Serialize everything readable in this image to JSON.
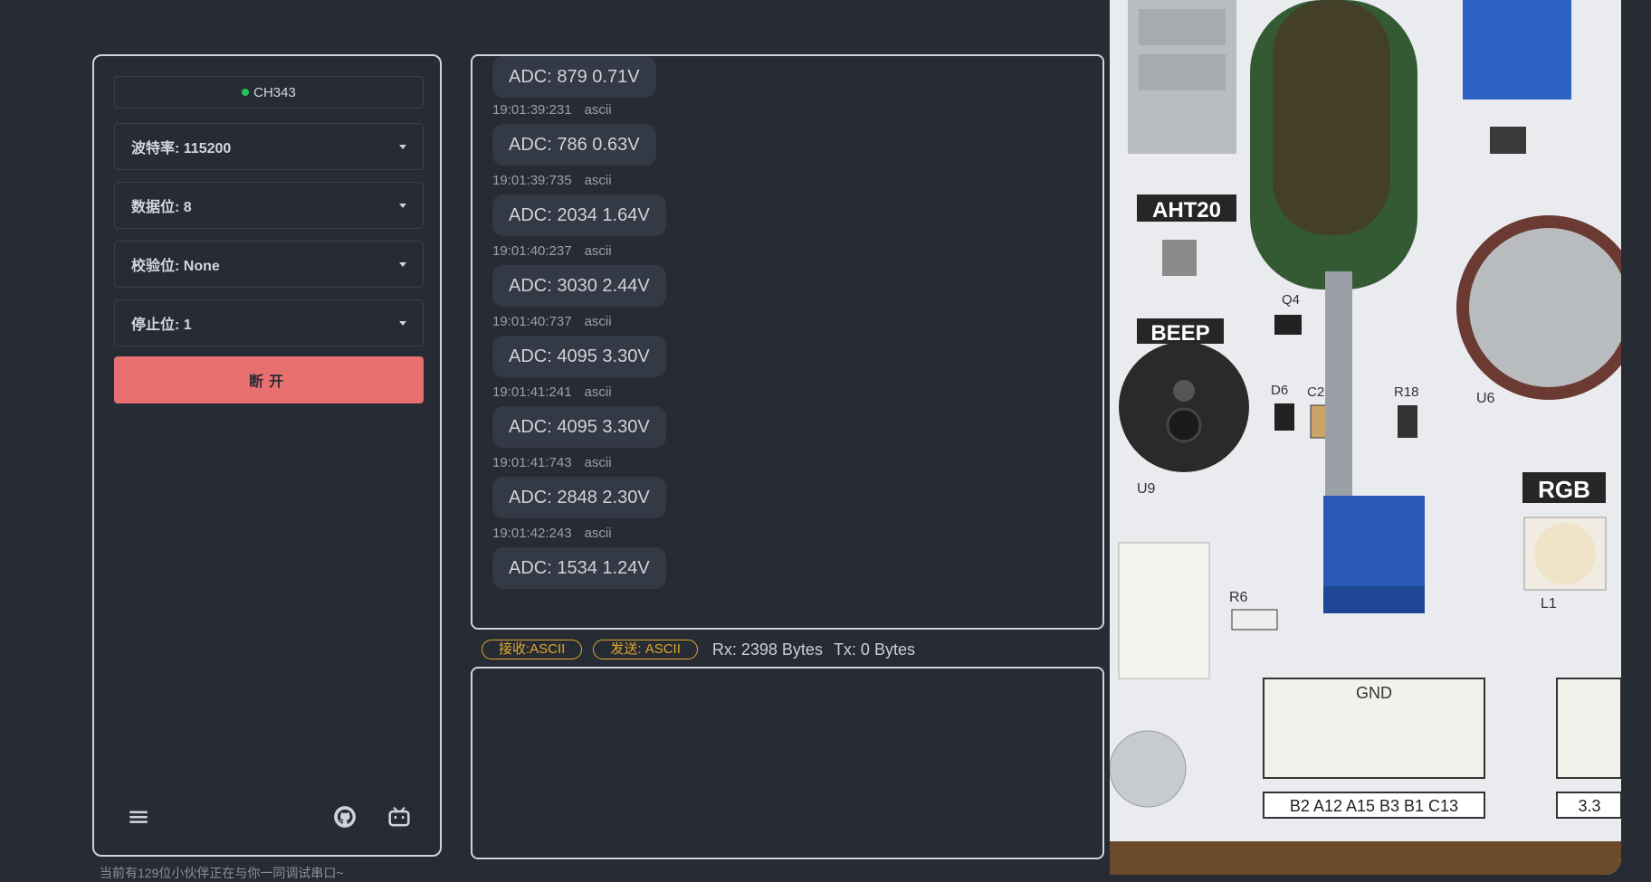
{
  "sidebar": {
    "port": "CH343",
    "baud": "波特率: 115200",
    "databits": "数据位: 8",
    "parity": "校验位: None",
    "stopbits": "停止位: 1",
    "disconnect": "断开"
  },
  "log": {
    "top_partial": "ADC: 879  0.71V",
    "messages": [
      {
        "time": "19:01:39:231",
        "format": "ascii",
        "text": "ADC: 786  0.63V"
      },
      {
        "time": "19:01:39:735",
        "format": "ascii",
        "text": "ADC: 2034  1.64V"
      },
      {
        "time": "19:01:40:237",
        "format": "ascii",
        "text": "ADC: 3030  2.44V"
      },
      {
        "time": "19:01:40:737",
        "format": "ascii",
        "text": "ADC: 4095  3.30V"
      },
      {
        "time": "19:01:41:241",
        "format": "ascii",
        "text": "ADC: 4095  3.30V"
      },
      {
        "time": "19:01:41:743",
        "format": "ascii",
        "text": "ADC: 2848  2.30V"
      },
      {
        "time": "19:01:42:243",
        "format": "ascii",
        "text": "ADC: 1534  1.24V"
      }
    ]
  },
  "status": {
    "rx_mode": "接收:ASCII",
    "tx_mode": "发送: ASCII",
    "rx": "Rx: 2398 Bytes",
    "tx": "Tx: 0 Bytes"
  },
  "online_users": "当前有129位小伙伴正在与你一同调试串口~",
  "board": {
    "labels": [
      "AHT20",
      "BEEP",
      "RGB",
      "Q4",
      "D6",
      "C26",
      "R18",
      "U6",
      "U9",
      "R6",
      "L1",
      "GND",
      "B2 A12 A15 B3 B1 C13",
      "3.3"
    ]
  },
  "icons": [
    "menu-icon",
    "github-icon",
    "bilibili-icon"
  ],
  "colors": {
    "background": "#262b34",
    "disconnect": "#e87070",
    "badge": "#e0a82e",
    "online-dot": "#22c55e"
  }
}
